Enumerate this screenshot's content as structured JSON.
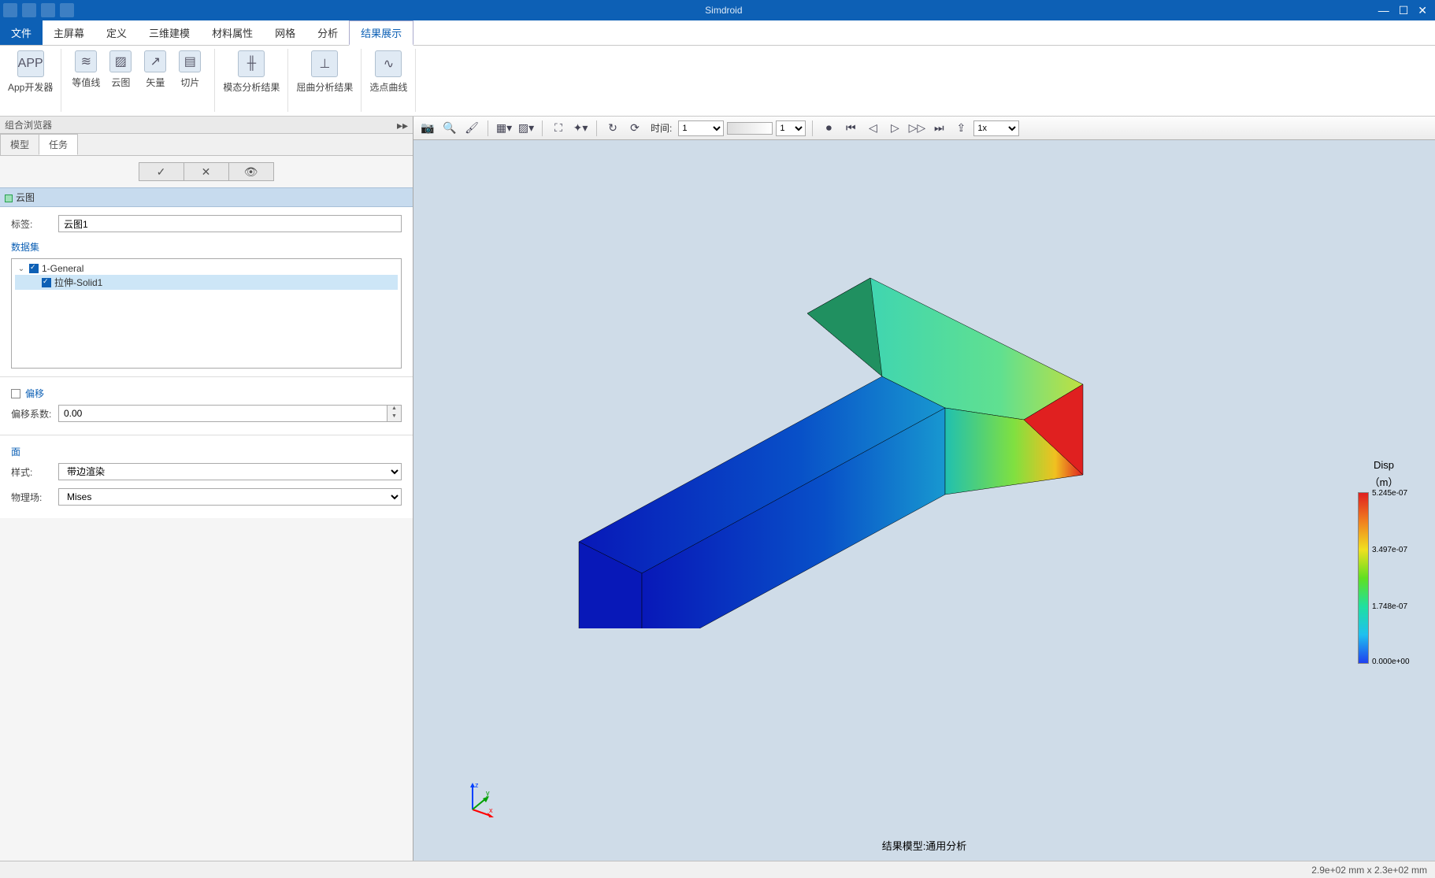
{
  "app": {
    "title": "Simdroid"
  },
  "win_controls": {
    "min": "—",
    "max": "☐",
    "close": "✕"
  },
  "menu": {
    "file": "文件",
    "items": [
      "主屏幕",
      "定义",
      "三维建模",
      "材料属性",
      "网格",
      "分析",
      "结果展示"
    ],
    "active_index": 6
  },
  "ribbon": {
    "app_dev": "App开发器",
    "contour": "等值线",
    "cloud": "云图",
    "vector": "矢量",
    "slice": "切片",
    "modal": "模态分析结果",
    "buckle": "屈曲分析结果",
    "curve": "选点曲线"
  },
  "side": {
    "panel_title": "组合浏览器",
    "tabs": {
      "model": "模型",
      "task": "任务"
    },
    "section_title": "云图",
    "label_tag": "标签:",
    "label_value": "云图1",
    "dataset_title": "数据集",
    "tree": {
      "root": "1-General",
      "child": "拉伸-Solid1"
    },
    "offset": {
      "title": "偏移",
      "coef_label": "偏移系数:",
      "value": "0.00"
    },
    "surface": {
      "title": "面",
      "style_label": "样式:",
      "style_value": "带边渲染",
      "phys_label": "物理场:",
      "phys_value": "Mises"
    }
  },
  "view_tb": {
    "time_label": "时间:",
    "time_value": "1",
    "frame_value": "1",
    "speed_value": "1x"
  },
  "colorbar": {
    "title1": "Disp",
    "title2": "（m）",
    "ticks": [
      "5.245e-07",
      "3.497e-07",
      "1.748e-07",
      "0.000e+00"
    ]
  },
  "model_label": "结果模型:通用分析",
  "status": "2.9e+02 mm x 2.3e+02 mm"
}
